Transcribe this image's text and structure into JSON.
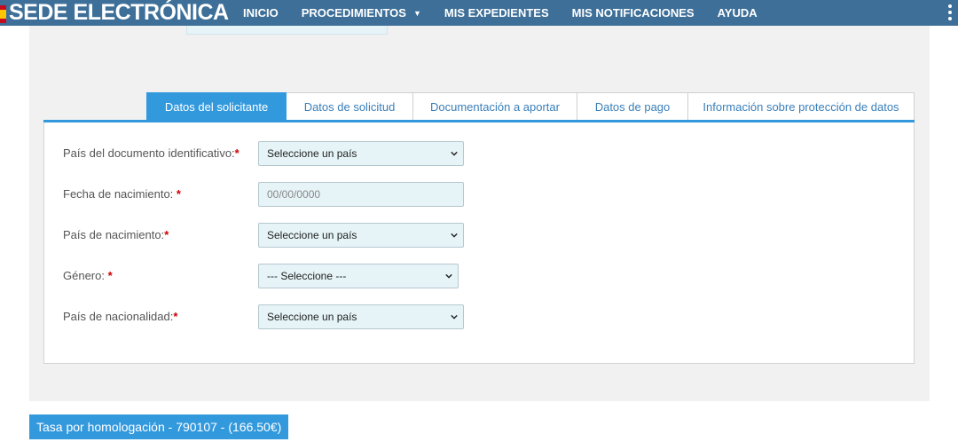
{
  "header": {
    "brand": "SEDE ELECTRÓNICA",
    "nav": [
      {
        "label": "INICIO"
      },
      {
        "label": "PROCEDIMIENTOS"
      },
      {
        "label": "MIS EXPEDIENTES"
      },
      {
        "label": "MIS NOTIFICACIONES"
      },
      {
        "label": "AYUDA"
      }
    ],
    "colors": {
      "bar": "#3d6f98",
      "accent": "#3399dd"
    }
  },
  "tabs": [
    {
      "label": "Datos del solicitante",
      "active": true
    },
    {
      "label": "Datos de solicitud",
      "active": false
    },
    {
      "label": "Documentación a aportar",
      "active": false
    },
    {
      "label": "Datos de pago",
      "active": false
    },
    {
      "label": "Información sobre protección de datos",
      "active": false
    }
  ],
  "form": {
    "doc_country": {
      "label": "País del documento identificativo:",
      "required": "*",
      "value": "Seleccione un país"
    },
    "birth_date": {
      "label": "Fecha de nacimiento: ",
      "required": "*",
      "placeholder": "00/00/0000"
    },
    "birth_country": {
      "label": "País de nacimiento:",
      "required": "*",
      "value": "Seleccione un país"
    },
    "gender": {
      "label": "Género: ",
      "required": "*",
      "value": "--- Seleccione ---"
    },
    "nationality": {
      "label": "País de nacionalidad:",
      "required": "*",
      "value": "Seleccione un país"
    }
  },
  "fee": {
    "label": "Tasa por homologación - 790107 - (166.50€)"
  }
}
